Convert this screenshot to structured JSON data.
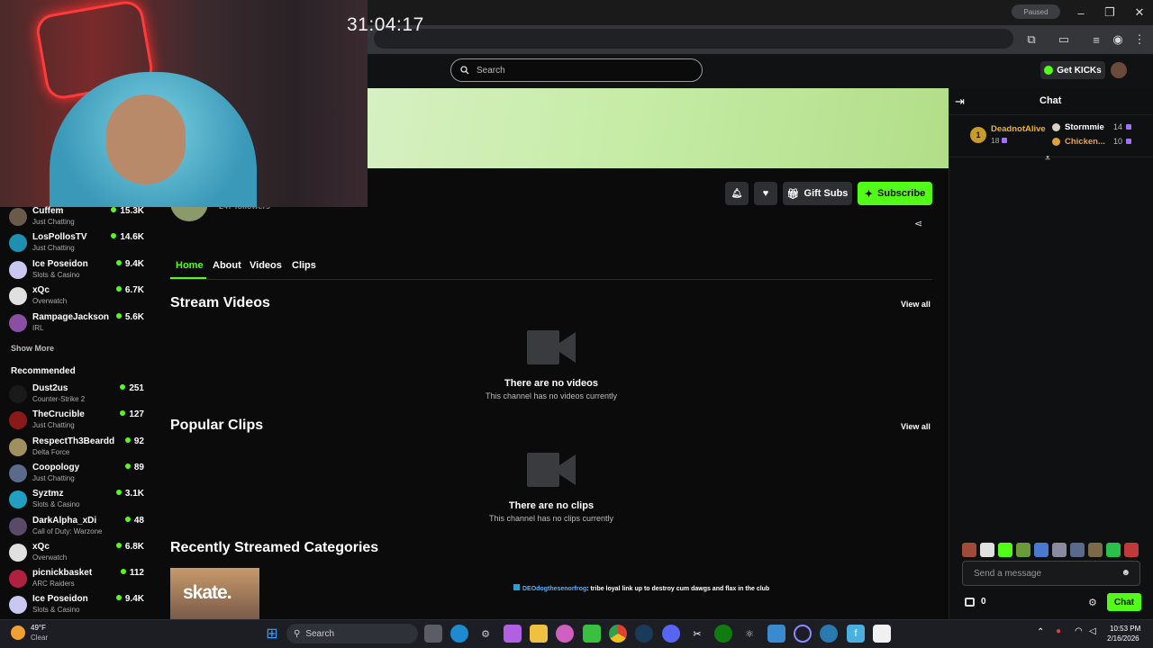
{
  "stream_timer": "31:04:17",
  "browser": {
    "profile_badge": "Paused"
  },
  "header": {
    "search_placeholder": "Search",
    "get_kicks_label": "Get KICKs"
  },
  "channel": {
    "followers_text": "247 followers",
    "gift_subs_label": "Gift Subs",
    "subscribe_label": "Subscribe",
    "tabs": [
      "Home",
      "About",
      "Videos",
      "Clips"
    ],
    "active_tab": "Home"
  },
  "sections": {
    "stream_videos": {
      "title": "Stream Videos",
      "view_all": "View all",
      "empty_title": "There are no videos",
      "empty_sub": "This channel has no videos currently"
    },
    "popular_clips": {
      "title": "Popular Clips",
      "view_all": "View all",
      "empty_title": "There are no clips",
      "empty_sub": "This channel has no clips currently"
    },
    "recent_categories": {
      "title": "Recently Streamed Categories",
      "category_logo_text": "skate."
    }
  },
  "sidebar": {
    "following": [
      {
        "name": "Cuffem",
        "category": "Just Chatting",
        "viewers": "15.3K",
        "color": "#6b5a4a"
      },
      {
        "name": "LosPollosTV",
        "category": "Just Chatting",
        "viewers": "14.6K",
        "color": "#1e8fb0"
      },
      {
        "name": "Ice Poseidon",
        "category": "Slots & Casino",
        "viewers": "9.4K",
        "color": "#c8c8f0"
      },
      {
        "name": "xQc",
        "category": "Overwatch",
        "viewers": "6.7K",
        "color": "#e0e0e0"
      },
      {
        "name": "RampageJackson",
        "category": "IRL",
        "viewers": "5.6K",
        "color": "#8a4fa0"
      }
    ],
    "show_more": "Show More",
    "recommended_title": "Recommended",
    "recommended": [
      {
        "name": "Dust2us",
        "category": "Counter-Strike 2",
        "viewers": "251",
        "color": "#1a1a1a"
      },
      {
        "name": "TheCrucible",
        "category": "Just Chatting",
        "viewers": "127",
        "color": "#8a1a1a"
      },
      {
        "name": "RespectTh3Beardd",
        "category": "Delta Force",
        "viewers": "92",
        "color": "#a09060"
      },
      {
        "name": "Coopology",
        "category": "Just Chatting",
        "viewers": "89",
        "color": "#5a6a8a"
      },
      {
        "name": "Syztmz",
        "category": "Slots & Casino",
        "viewers": "3.1K",
        "color": "#20a0c0"
      },
      {
        "name": "DarkAlpha_xDi",
        "category": "Call of Duty: Warzone",
        "viewers": "48",
        "color": "#5a4a6a"
      },
      {
        "name": "xQc",
        "category": "Overwatch",
        "viewers": "6.8K",
        "color": "#e0e0e0"
      },
      {
        "name": "picnickbasket",
        "category": "ARC Raiders",
        "viewers": "112",
        "color": "#b02040"
      },
      {
        "name": "Ice Poseidon",
        "category": "Slots & Casino",
        "viewers": "9.4K",
        "color": "#c8c8f0"
      }
    ]
  },
  "chat": {
    "title": "Chat",
    "leaderboard": [
      {
        "rank": "1",
        "name": "DeadnotAlive",
        "count": "18"
      },
      {
        "name": "Stormmie",
        "count": "14"
      },
      {
        "name": "Chicken...",
        "count": "10"
      }
    ],
    "overlay_message_user": "DEOdogthesenorfrog",
    "overlay_message_text": ": tribe loyal link up to destroy cum dawgs and flax in the club",
    "input_placeholder": "Send a message",
    "points": "0",
    "send_label": "Chat"
  },
  "taskbar": {
    "weather_temp": "49°F",
    "weather_cond": "Clear",
    "search_placeholder": "Search",
    "time": "10:53 PM",
    "date": "2/16/2026"
  },
  "colors": {
    "accent": "#53fc18",
    "background": "#0b0b0c"
  }
}
